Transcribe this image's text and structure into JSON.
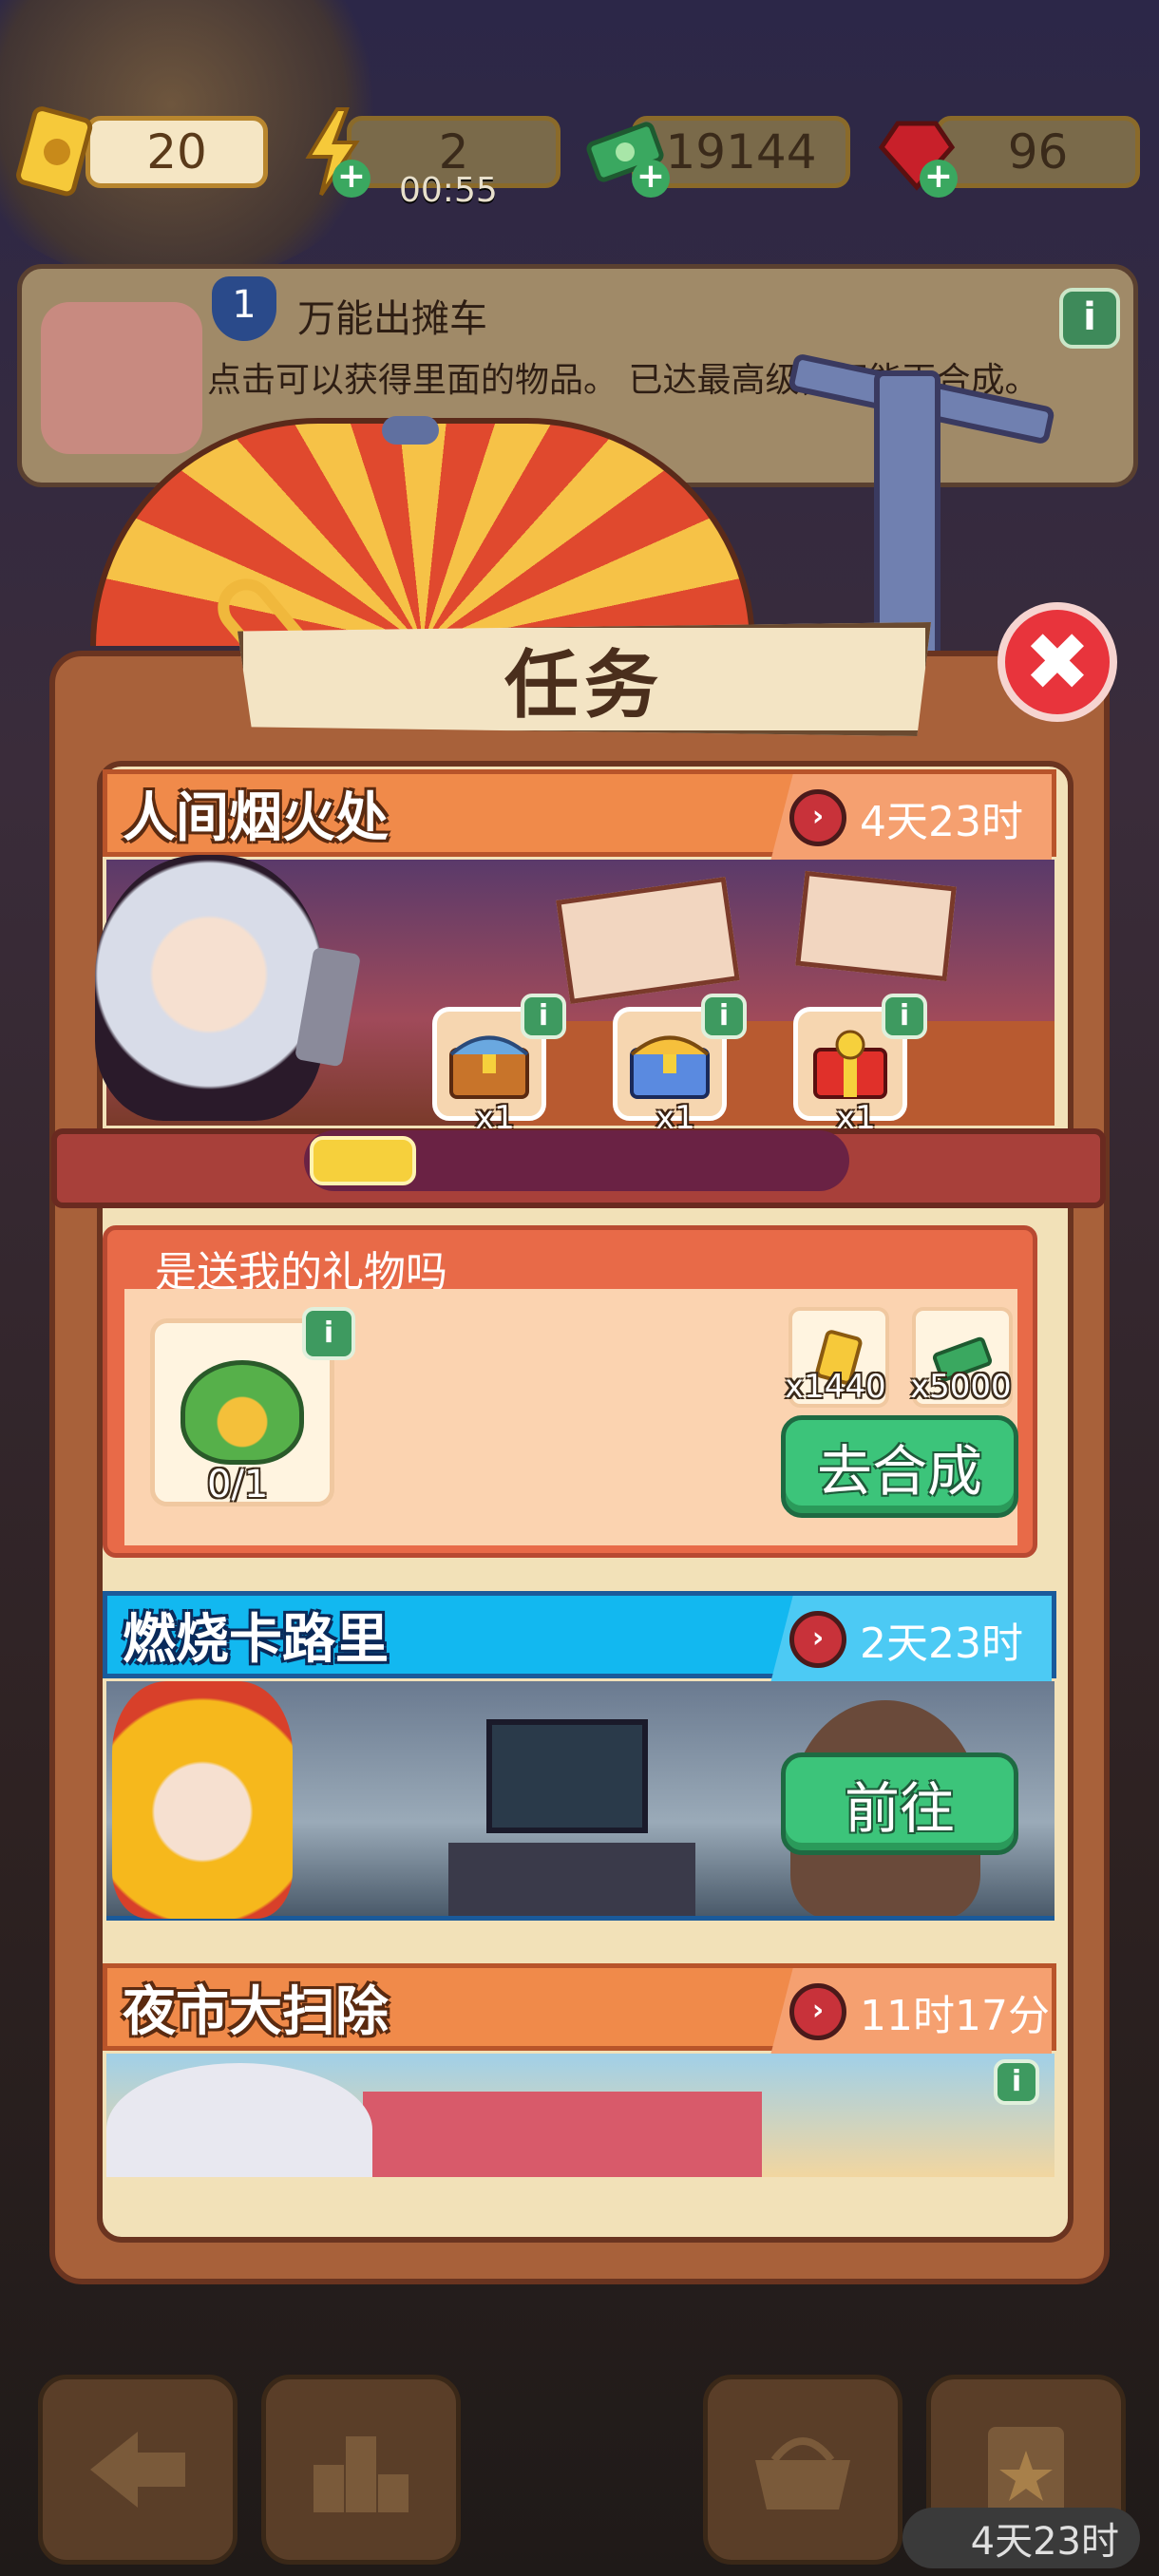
{
  "currencies": {
    "tickets": {
      "value": "20",
      "icon": "ticket-icon"
    },
    "energy": {
      "value": "2",
      "timer": "00:55",
      "icon": "lightning-icon"
    },
    "cash": {
      "value": "19144",
      "icon": "cash-icon"
    },
    "gems": {
      "value": "96",
      "icon": "ruby-icon"
    }
  },
  "info_card": {
    "level": "1",
    "title": "万能出摊车",
    "description": "点击可以获得里面的物品。 已达最高级，不能再合成。",
    "info_icon": "i"
  },
  "dialog": {
    "title": "任务",
    "close_icon": "✖"
  },
  "quests": [
    {
      "name": "人间烟火处",
      "time_left": "4天23时",
      "header_color": "#f08a4a",
      "rewards": [
        {
          "icon": "chest-blue-icon",
          "count": "x1"
        },
        {
          "icon": "chest-gold-icon",
          "count": "x1"
        },
        {
          "icon": "gift-red-icon",
          "count": "x1"
        }
      ],
      "progress": 0.2,
      "task": {
        "title": "是送我的礼物吗",
        "item_progress": "0/1",
        "rewards": [
          {
            "icon": "ticket-icon",
            "amount": "x1440"
          },
          {
            "icon": "cash-icon",
            "amount": "x5000"
          }
        ],
        "button": "去合成"
      }
    },
    {
      "name": "燃烧卡路里",
      "time_left": "2天23时",
      "header_color": "#12b8f0",
      "button": "前往"
    },
    {
      "name": "夜市大扫除",
      "time_left": "11时17分",
      "header_color": "#f08a4a"
    }
  ],
  "bottom_nav": {
    "timer": "4天23时"
  }
}
